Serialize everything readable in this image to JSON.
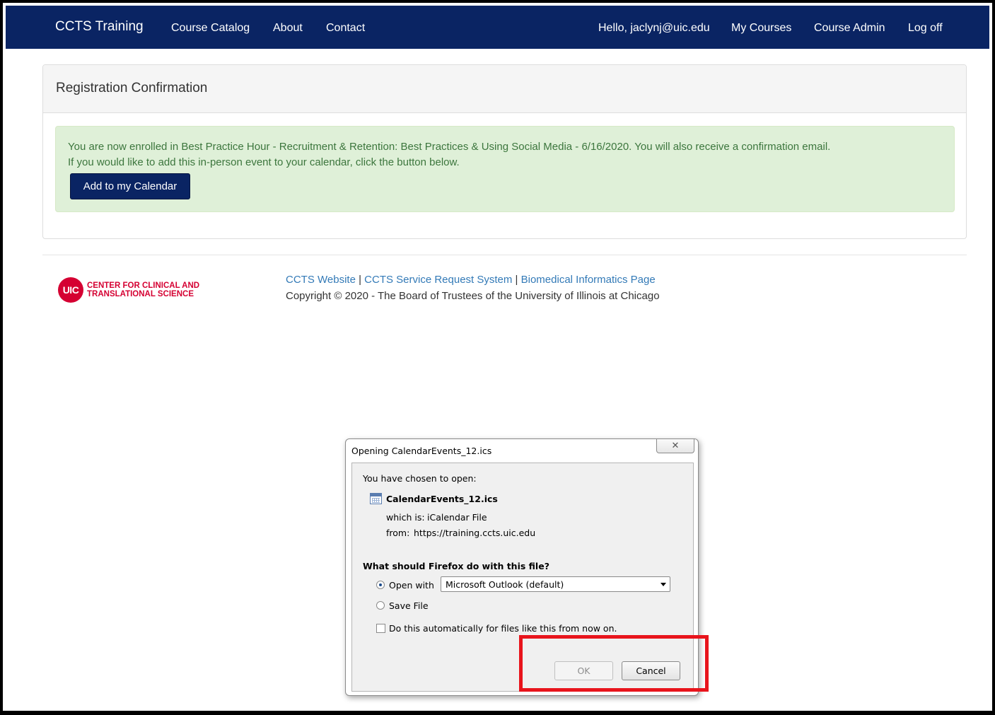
{
  "navbar": {
    "brand": "CCTS Training",
    "links": [
      "Course Catalog",
      "About",
      "Contact"
    ],
    "right_links": [
      "Hello, jaclynj@uic.edu",
      "My Courses",
      "Course Admin",
      "Log off"
    ]
  },
  "panel": {
    "title": "Registration Confirmation",
    "alert_line1": "You are now enrolled in Best Practice Hour - Recruitment & Retention: Best Practices & Using Social Media - 6/16/2020. You will also receive a confirmation email.",
    "alert_line2": "If you would like to add this in-person event to your calendar, click the button below.",
    "calendar_button": "Add to my Calendar"
  },
  "footer": {
    "logo_line1": "CENTER FOR CLINICAL AND",
    "logo_line2": "TRANSLATIONAL SCIENCE",
    "logo_badge": "UIC",
    "link1": "CCTS Website",
    "link2": "CCTS Service Request System",
    "link3": "Biomedical Informatics Page",
    "separator": " | ",
    "copyright": "Copyright © 2020 - The Board of Trustees of the University of Illinois at Chicago"
  },
  "dialog": {
    "title": "Opening CalendarEvents_12.ics",
    "close_glyph": "✕",
    "chosen": "You have chosen to open:",
    "file_name": "CalendarEvents_12.ics",
    "which_is_label": "which is:",
    "which_is_value": "iCalendar File",
    "from_label": "from:",
    "from_value": "https://training.ccts.uic.edu",
    "question": "What should Firefox do with this file?",
    "open_with_label": "Open with",
    "open_with_value": "Microsoft Outlook (default)",
    "save_file_label": "Save File",
    "auto_label": "Do this automatically for files like this from now on.",
    "ok_label": "OK",
    "cancel_label": "Cancel"
  }
}
